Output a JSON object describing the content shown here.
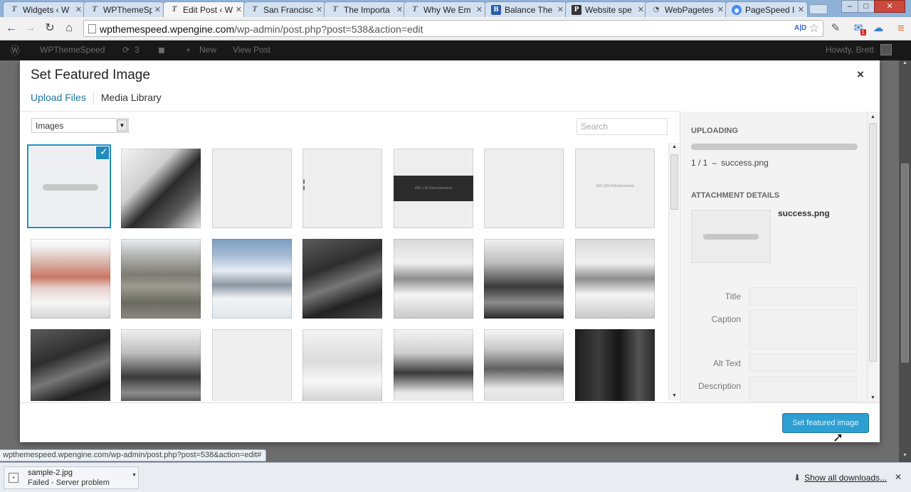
{
  "browser": {
    "tabs": [
      {
        "title": "Widgets ‹ W",
        "icon": "wordpress-favicon-icon"
      },
      {
        "title": "WPThemeSp",
        "icon": "wordpress-favicon-icon"
      },
      {
        "title": "Edit Post ‹ W",
        "icon": "wordpress-favicon-icon",
        "active": true
      },
      {
        "title": "San Francisc",
        "icon": "wordpress-favicon-icon"
      },
      {
        "title": "The Importa",
        "icon": "wordpress-favicon-icon"
      },
      {
        "title": "Why We Em",
        "icon": "wordpress-favicon-icon"
      },
      {
        "title": "Balance The",
        "icon": "balance-favicon-icon"
      },
      {
        "title": "Website spe",
        "icon": "p-favicon-icon"
      },
      {
        "title": "WebPagetes",
        "icon": "gauge-favicon-icon"
      },
      {
        "title": "PageSpeed I",
        "icon": "pagespeed-favicon-icon"
      }
    ],
    "url_host": "wpthemespeed.wpengine.com",
    "url_path": "/wp-admin/post.php?post=538&action=edit",
    "translate_glyph": "A|D",
    "mail_badge": "1"
  },
  "adminbar": {
    "site_name": "WPThemeSpeed",
    "updates_count": "3",
    "new_label": "New",
    "view_label": "View Post",
    "howdy": "Howdy, Brett"
  },
  "modal": {
    "title": "Set Featured Image",
    "close_glyph": "×",
    "router": {
      "upload": "Upload Files",
      "library": "Media Library"
    },
    "filter_value": "Images",
    "search_placeholder": "Search",
    "grid": [
      {
        "kind": "placeholder",
        "selected": true
      },
      {
        "kind": "photo",
        "style": "phone"
      },
      {
        "kind": "blank"
      },
      {
        "kind": "glyph",
        "text": "¦"
      },
      {
        "kind": "ad-dark",
        "text": "468 x 60 Advertisement"
      },
      {
        "kind": "blank"
      },
      {
        "kind": "ad-light",
        "text": "300 x250 Advertisement"
      },
      {
        "kind": "photo",
        "style": "mountain1"
      },
      {
        "kind": "photo",
        "style": "mountain2"
      },
      {
        "kind": "photo",
        "style": "mountain3"
      },
      {
        "kind": "photo",
        "style": "chairs"
      },
      {
        "kind": "photo",
        "style": "office"
      },
      {
        "kind": "photo",
        "style": "airport"
      },
      {
        "kind": "photo",
        "style": "office"
      },
      {
        "kind": "photo",
        "style": "chairs"
      },
      {
        "kind": "photo",
        "style": "airport"
      },
      {
        "kind": "blank"
      },
      {
        "kind": "photo",
        "style": "drawing"
      },
      {
        "kind": "photo",
        "style": "meeting"
      },
      {
        "kind": "photo",
        "style": "headset"
      },
      {
        "kind": "photo",
        "style": "server"
      }
    ],
    "sidebar": {
      "uploading_heading": "Uploading",
      "progress": 1.0,
      "upload_count": "1 / 1",
      "upload_dash": "–",
      "upload_file": "success.png",
      "details_heading": "Attachment Details",
      "filename": "success.png",
      "fields": {
        "title": "Title",
        "caption": "Caption",
        "alt": "Alt Text",
        "description": "Description"
      }
    },
    "primary_button": "Set featured image"
  },
  "background_text": "...",
  "status_url": "wpthemespeed.wpengine.com/wp-admin/post.php?post=538&action=edit#",
  "downloads": {
    "file_name": "sample-2.jpg",
    "file_status": "Failed - Server problem",
    "show_all": "Show all downloads...",
    "close_glyph": "✕"
  },
  "colors": {
    "accent": "#1e8cbe",
    "primary_button": "#2e9fd2",
    "admin_bar": "#181818"
  }
}
